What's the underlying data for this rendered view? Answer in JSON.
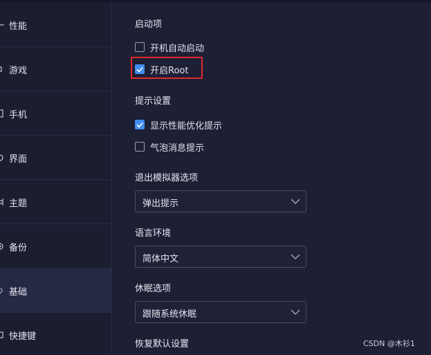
{
  "sidebar": {
    "items": [
      {
        "label": "性能",
        "icon": "performance-icon"
      },
      {
        "label": "游戏",
        "icon": "game-icon"
      },
      {
        "label": "手机",
        "icon": "phone-icon"
      },
      {
        "label": "界面",
        "icon": "interface-icon"
      },
      {
        "label": "主题",
        "icon": "theme-icon"
      },
      {
        "label": "备份",
        "icon": "backup-icon"
      },
      {
        "label": "基础",
        "icon": "gear-icon",
        "active": true
      },
      {
        "label": "快捷键",
        "icon": "keyboard-icon"
      }
    ]
  },
  "startup": {
    "title": "启动项",
    "options": [
      {
        "label": "开机自动启动",
        "checked": false
      },
      {
        "label": "开启Root",
        "checked": true
      }
    ]
  },
  "tips": {
    "title": "提示设置",
    "options": [
      {
        "label": "显示性能优化提示",
        "checked": true
      },
      {
        "label": "气泡消息提示",
        "checked": false
      }
    ]
  },
  "exit": {
    "title": "退出模拟器选项",
    "value": "弹出提示"
  },
  "language": {
    "title": "语言环境",
    "value": "简体中文"
  },
  "sleep": {
    "title": "休眠选项",
    "value": "跟随系统休眠"
  },
  "reset": {
    "title": "恢复默认设置"
  },
  "watermark": "CSDN @木衫1",
  "colors": {
    "accent": "#3f8ef0",
    "highlight": "#e42a2a",
    "background": "#1d1f35"
  }
}
